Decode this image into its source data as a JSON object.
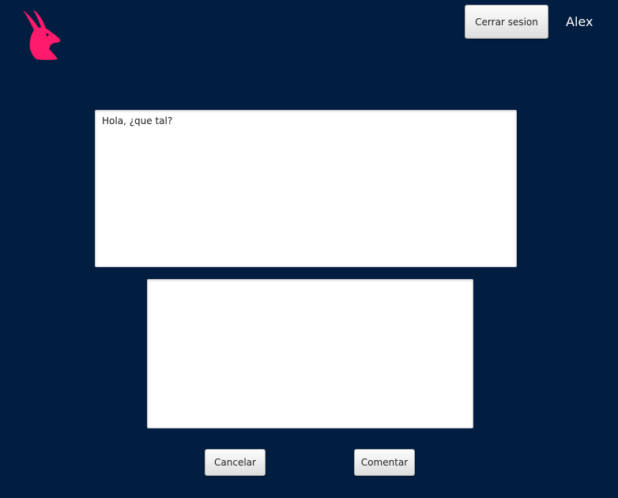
{
  "brand": {
    "logo_icon": "rabbit-icon",
    "logo_color": "#ff1a6c"
  },
  "header": {
    "logout_label": "Cerrar sesion",
    "username": "Alex"
  },
  "post": {
    "text": "Hola, ¿que tal?"
  },
  "comment": {
    "text": ""
  },
  "actions": {
    "cancel_label": "Cancelar",
    "comment_label": "Comentar"
  },
  "colors": {
    "background": "#011d40",
    "text_area": "#ffffff"
  }
}
